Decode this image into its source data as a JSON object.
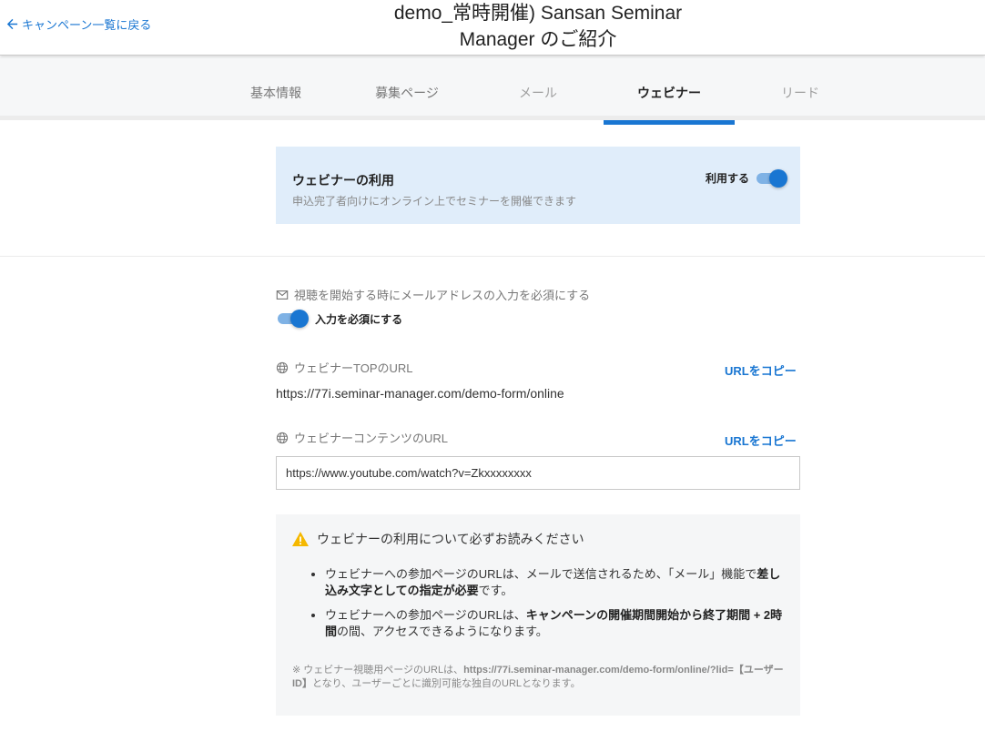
{
  "header": {
    "back_label": "キャンペーン一覧に戻る",
    "title_line1": "demo_常時開催) Sansan Seminar",
    "title_line2": "Manager のご紹介"
  },
  "tabs": [
    {
      "label": "基本情報"
    },
    {
      "label": "募集ページ"
    },
    {
      "label": "メール"
    },
    {
      "label": "ウェビナー"
    },
    {
      "label": "リード"
    }
  ],
  "webinar_usage": {
    "title": "ウェビナーの利用",
    "description": "申込完了者向けにオンライン上でセミナーを開催できます",
    "toggle_label": "利用する",
    "enabled": true
  },
  "email_requirement": {
    "label": "視聴を開始する時にメールアドレスの入力を必須にする",
    "toggle_label": "入力を必須にする",
    "enabled": true
  },
  "webinar_top_url": {
    "label": "ウェビナーTOPのURL",
    "copy_label": "URLをコピー",
    "value": "https://77i.seminar-manager.com/demo-form/online"
  },
  "webinar_content_url": {
    "label": "ウェビナーコンテンツのURL",
    "copy_label": "URLをコピー",
    "value": "https://www.youtube.com/watch?v=Zkxxxxxxxx"
  },
  "notice": {
    "title": "ウェビナーの利用について必ずお読みください",
    "item1_a": "ウェビナーへの参加ページのURLは、メールで送信されるため、「メール」機能で",
    "item1_b": "差し込み文字としての指定が必要",
    "item1_c": "です。",
    "item2_a": "ウェビナーへの参加ページのURLは、",
    "item2_b": "キャンペーンの開催期間開始から終了期間 + 2時間",
    "item2_c": "の間、アクセスできるようになります。",
    "footnote_a": "※ ウェビナー視聴用ページのURLは、",
    "footnote_b": "https://77i.seminar-manager.com/demo-form/online/?lid=【ユーザーID】",
    "footnote_c": "となり、ユーザーごとに識別可能な独自のURLとなります。"
  },
  "colors": {
    "accent": "#1976d2",
    "panel_bg": "#e0edfa",
    "notice_bg": "#f5f6f7",
    "warning": "#f5b800"
  }
}
